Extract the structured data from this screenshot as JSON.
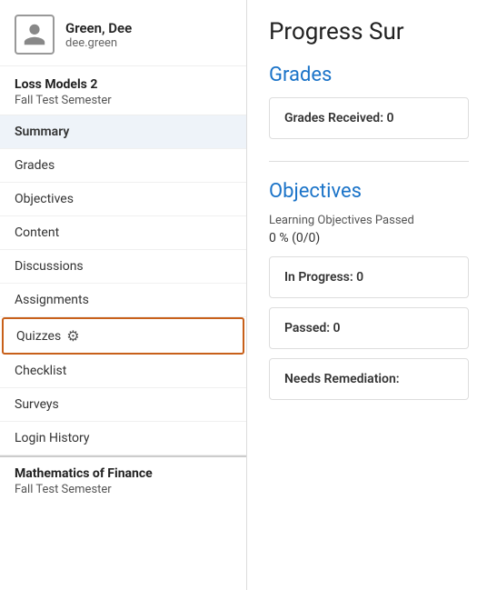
{
  "user": {
    "name": "Green, Dee",
    "username": "dee.green"
  },
  "course": {
    "name": "Loss Models 2",
    "semester": "Fall Test Semester"
  },
  "second_course": {
    "name": "Mathematics of Finance",
    "semester": "Fall Test Semester"
  },
  "nav": {
    "items": [
      {
        "label": "Summary",
        "active": true,
        "id": "summary"
      },
      {
        "label": "Grades",
        "active": false,
        "id": "grades"
      },
      {
        "label": "Objectives",
        "active": false,
        "id": "objectives"
      },
      {
        "label": "Content",
        "active": false,
        "id": "content"
      },
      {
        "label": "Discussions",
        "active": false,
        "id": "discussions"
      },
      {
        "label": "Assignments",
        "active": false,
        "id": "assignments"
      },
      {
        "label": "Quizzes",
        "active": false,
        "id": "quizzes",
        "special": true
      },
      {
        "label": "Checklist",
        "active": false,
        "id": "checklist"
      },
      {
        "label": "Surveys",
        "active": false,
        "id": "surveys"
      },
      {
        "label": "Login History",
        "active": false,
        "id": "login-history"
      }
    ]
  },
  "main": {
    "title": "Progress Sur",
    "grades_section": {
      "title": "Grades",
      "card": "Grades Received: 0"
    },
    "objectives_section": {
      "title": "Objectives",
      "sub_label": "Learning Objectives Passed",
      "percent": "0 % (0/0)",
      "cards": [
        "In Progress: 0",
        "Passed: 0",
        "Needs Remediation:"
      ]
    }
  }
}
